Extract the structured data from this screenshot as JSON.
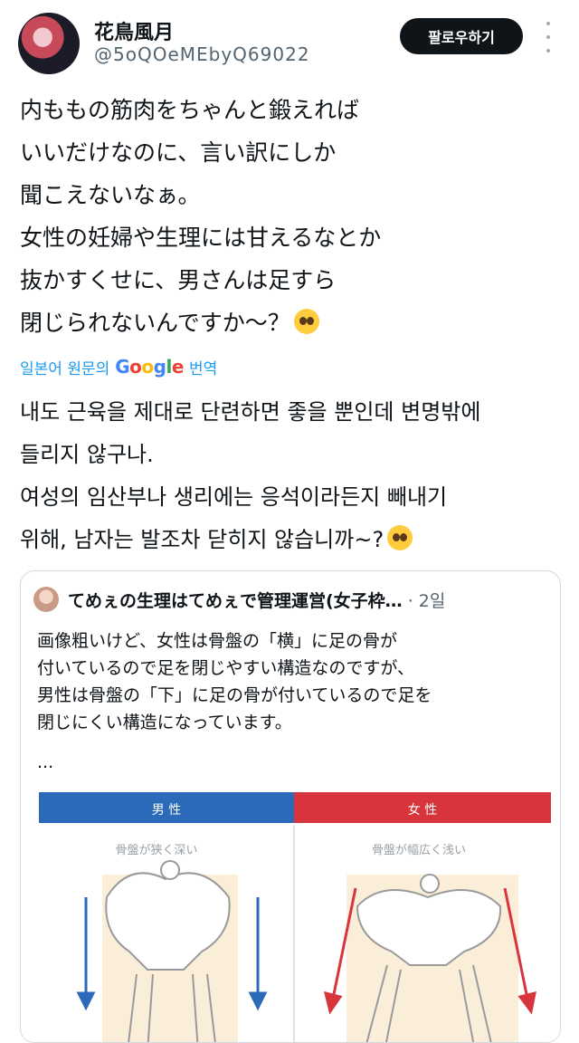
{
  "author": {
    "display_name": "花鳥風月",
    "handle": "@5oQOeMEbyQ69022",
    "follow_label": "팔로우하기"
  },
  "tweet": {
    "lines": [
      "内ももの筋肉をちゃんと鍛えれば",
      "いいだけなのに、言い訳にしか",
      "聞こえないなぁ。",
      "女性の妊婦や生理には甘えるなとか",
      "抜かすくせに、男さんは足すら",
      "閉じられないんですか〜？"
    ]
  },
  "translate": {
    "prefix": "일본어 원문의",
    "google": [
      "G",
      "o",
      "o",
      "g",
      "l",
      "e"
    ],
    "suffix": "번역"
  },
  "translation": {
    "lines": [
      "내도 근육을 제대로 단련하면 좋을 뿐인데 변명밖에",
      "들리지 않구나.",
      "여성의 임산부나 생리에는 응석이라든지 빼내기",
      "위해, 남자는 발조차 닫히지 않습니까~?"
    ]
  },
  "quote": {
    "name": "てめぇの生理はてめぇで管理運営(女子枠…",
    "time": "· 2일",
    "lines": [
      "画像粗いけど、女性は骨盤の「横」に足の骨が",
      "付いているので足を閉じやすい構造なのですが、",
      "男性は骨盤の「下」に足の骨が付いているので足を",
      "閉じにくい構造になっています。"
    ],
    "ellipsis": "...",
    "image": {
      "left_header": "男 性",
      "right_header": "女 性",
      "left_caption": "骨盤が狭く深い",
      "right_caption": "骨盤が幅広く浅い"
    }
  },
  "colors": {
    "link": "#1d9bf0",
    "male_bar": "#2a6ab8",
    "female_bar": "#d8343c",
    "skin": "#f6e3c0"
  }
}
